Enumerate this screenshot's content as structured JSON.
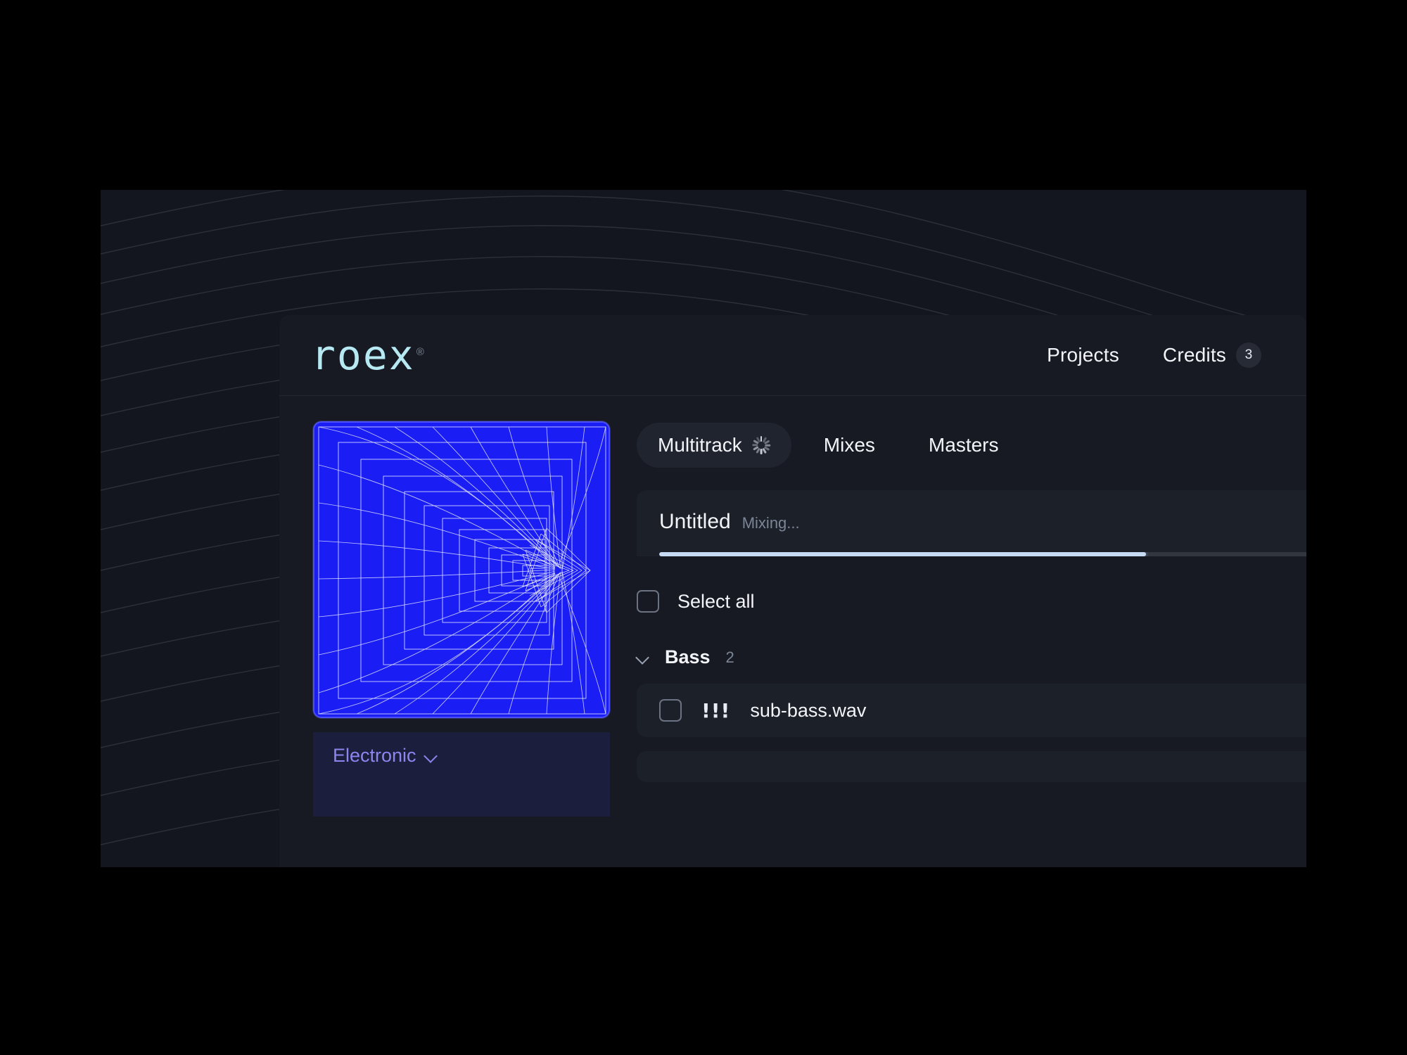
{
  "app": {
    "brand": "roex",
    "brand_reg": "®"
  },
  "header": {
    "nav": [
      {
        "label": "Projects",
        "name": "nav-projects"
      },
      {
        "label": "Credits",
        "name": "nav-credits",
        "badge": "3"
      }
    ]
  },
  "tabs": [
    {
      "label": "Multitrack",
      "active": true,
      "icon": "spinner-icon"
    },
    {
      "label": "Mixes",
      "active": false
    },
    {
      "label": "Masters",
      "active": false
    }
  ],
  "project": {
    "name": "Untitled",
    "status": "Mixing...",
    "progress_percent": 66
  },
  "artwork": {
    "alt": "blue-wireframe-tunnel-artwork",
    "base_color": "#1a1ef5",
    "line_color": "#cfd4ff"
  },
  "genre": {
    "label": "Electronic",
    "color": "#8e85ee"
  },
  "file_list": {
    "select_all_label": "Select all",
    "groups": [
      {
        "name": "Bass",
        "count": "2",
        "expanded": true,
        "tracks": [
          {
            "filename": "sub-bass.wav",
            "warning": "!!!",
            "checked": false
          }
        ]
      }
    ]
  },
  "colors": {
    "accent_brand": "#b7e9f2",
    "accent_progress": "#c7dbf5",
    "panel_bg": "#171a23",
    "card_bg": "#1c2029",
    "page_bg": "#13161e",
    "genre_panel": "#1b1e3c"
  }
}
